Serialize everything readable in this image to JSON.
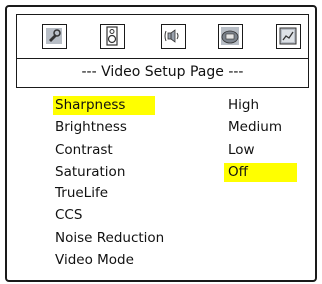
{
  "page_title": "--- Video Setup Page ---",
  "icons": [
    {
      "name": "general-setup-icon"
    },
    {
      "name": "speaker-setup-icon"
    },
    {
      "name": "audio-setup-icon"
    },
    {
      "name": "video-setup-icon"
    },
    {
      "name": "preference-setup-icon"
    }
  ],
  "menu_items": [
    "Sharpness",
    "Brightness",
    "Contrast",
    "Saturation",
    "TrueLife",
    "CCS",
    "Noise Reduction",
    "Video Mode"
  ],
  "selected_item": "Sharpness",
  "options": [
    "High",
    "Medium",
    "Low",
    "Off"
  ],
  "selected_option": "Off",
  "colors": {
    "highlight": "#ffff00",
    "border": "#1a1a1a",
    "icon_fill": "#b8bec6"
  }
}
